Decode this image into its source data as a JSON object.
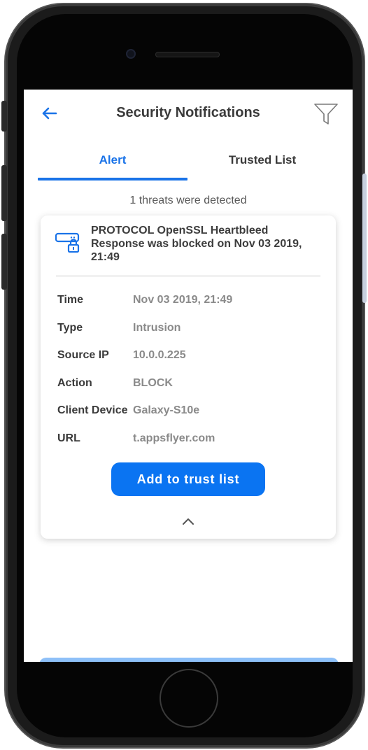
{
  "screen": {
    "title": "Security Notifications",
    "back_icon": "arrow-left-icon",
    "filter_icon": "funnel-icon"
  },
  "tabs": [
    {
      "label": "Alert",
      "active": true
    },
    {
      "label": "Trusted List",
      "active": false
    }
  ],
  "summary": {
    "threats_text": "1 threats were detected"
  },
  "alert_card": {
    "icon": "router-lock-icon",
    "title": "PROTOCOL OpenSSL Heartbleed Response was blocked on Nov 03 2019, 21:49",
    "details": [
      {
        "label": "Time",
        "value": "Nov 03 2019, 21:49"
      },
      {
        "label": "Type",
        "value": "Intrusion"
      },
      {
        "label": "Source IP",
        "value": "10.0.0.225"
      },
      {
        "label": "Action",
        "value": "BLOCK"
      },
      {
        "label": "Client Device",
        "value": "Galaxy-S10e"
      },
      {
        "label": "URL",
        "value": "t.appsflyer.com"
      }
    ],
    "button_label": "Add to trust list",
    "collapse_icon": "chevron-up-icon"
  },
  "colors": {
    "accent": "#1a73e8",
    "button": "#0a74f2",
    "label": "#3a3a3a",
    "value": "#8a8a8a"
  }
}
